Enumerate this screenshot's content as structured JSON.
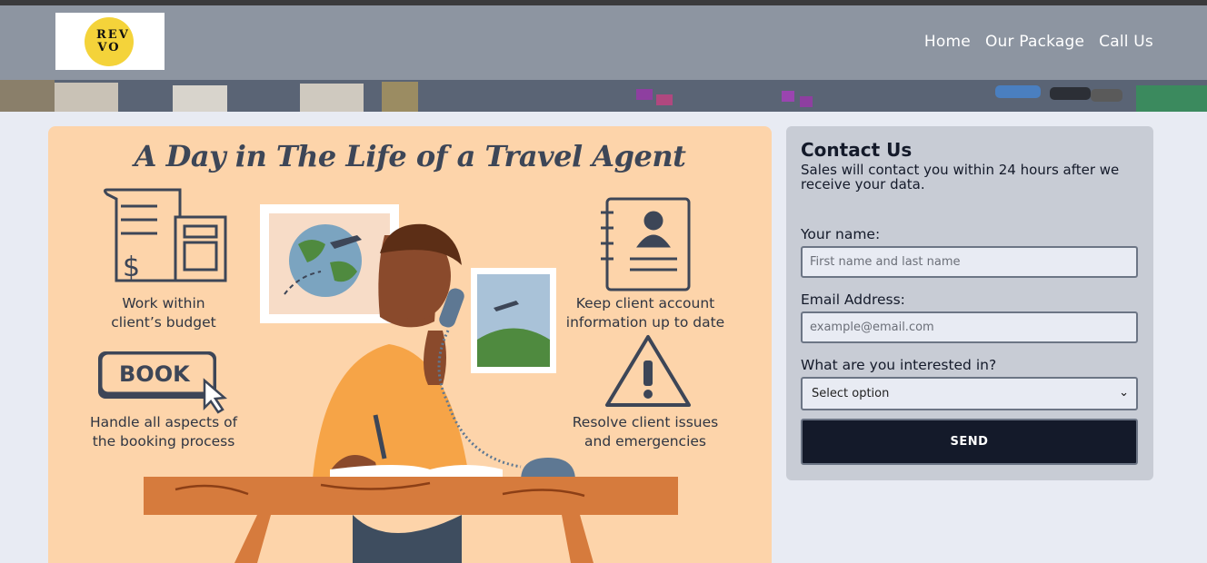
{
  "header": {
    "logo_text_top": "REV",
    "logo_text_bottom": "VO",
    "nav": [
      "Home",
      "Our Package",
      "Call Us"
    ]
  },
  "infographic": {
    "title": "A Day in The Life of a Travel Agent",
    "items": [
      {
        "label_line1": "Work within",
        "label_line2": "client’s budget",
        "icon": "receipt-calculator-icon"
      },
      {
        "label_line1": "Keep client account",
        "label_line2": "information up to date",
        "icon": "address-book-icon"
      },
      {
        "label_line1": "Handle all aspects of",
        "label_line2": "the booking process",
        "icon": "book-button-icon"
      },
      {
        "label_line1": "Resolve client issues",
        "label_line2": "and emergencies",
        "icon": "warning-icon"
      }
    ],
    "book_button_text": "BOOK"
  },
  "contact": {
    "title": "Contact Us",
    "subtitle": "Sales will contact you within 24 hours after we receive your data.",
    "name_label": "Your name:",
    "name_placeholder": "First name and last name",
    "email_label": "Email Address:",
    "email_placeholder": "example@email.com",
    "interest_label": "What are you interested in?",
    "interest_selected": "Select option",
    "send_label": "SEND"
  },
  "colors": {
    "header_bg": "#8d95a1",
    "card_bg": "#fdd4aa",
    "contact_bg": "#c8ccd5",
    "send_bg": "#141a2a",
    "page_bg": "#e8ebf3"
  }
}
